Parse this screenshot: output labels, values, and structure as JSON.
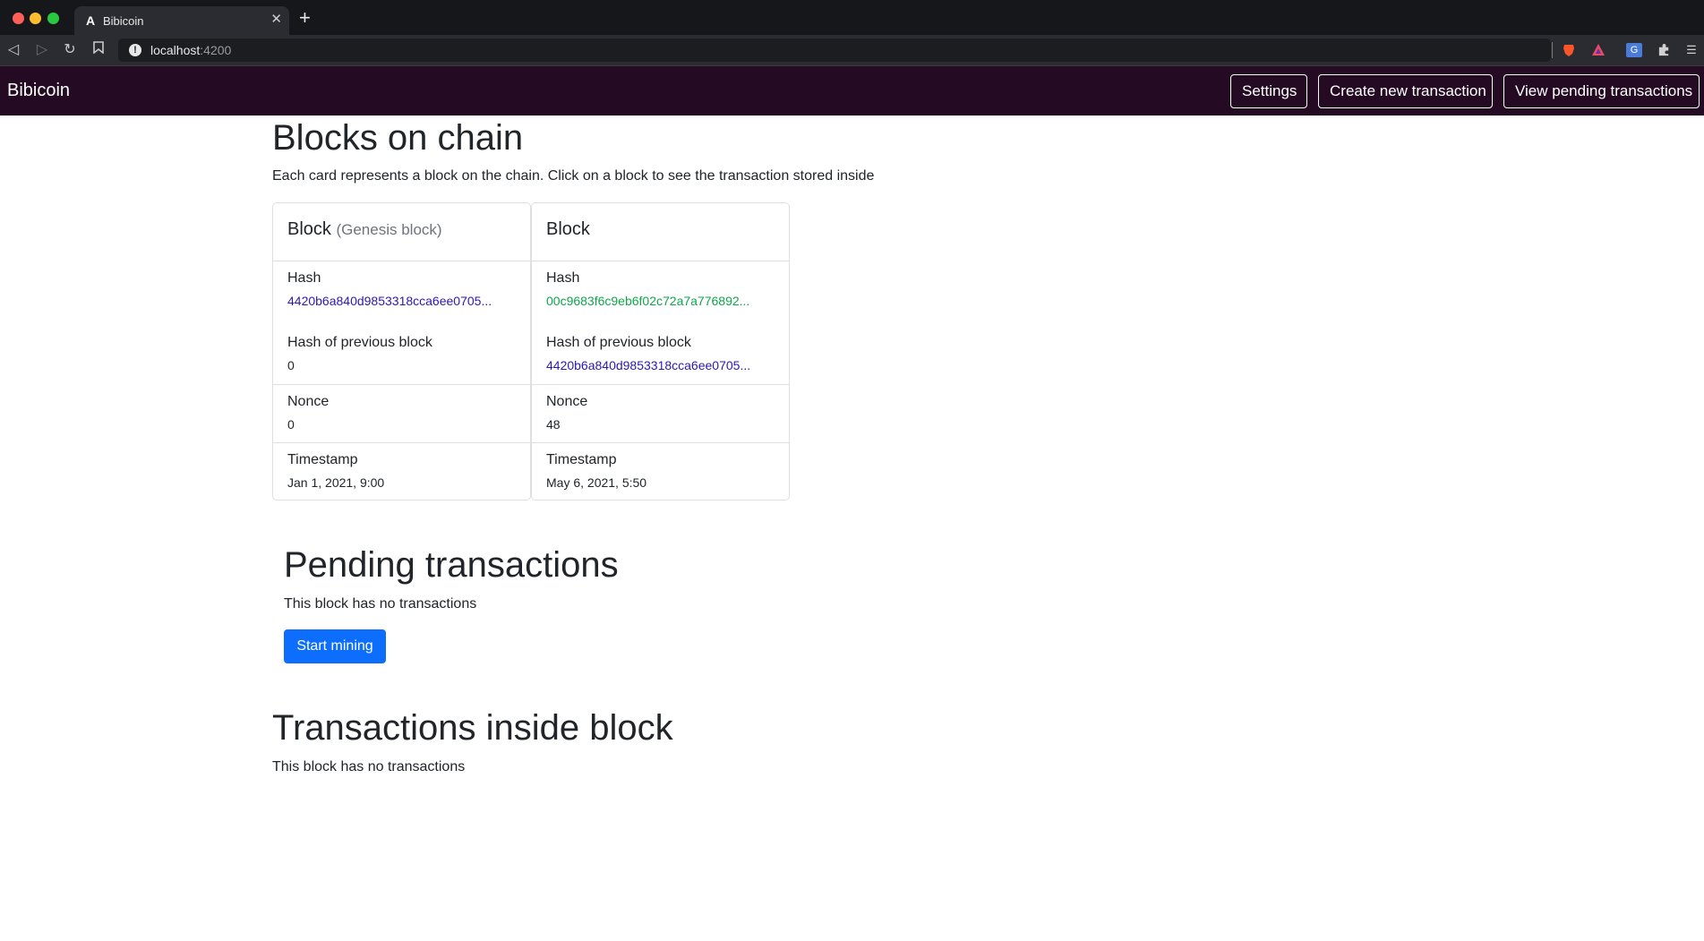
{
  "browser": {
    "tab_title": "Bibicoin",
    "tab_favicon": "A",
    "tab_close": "✕",
    "new_tab": "+",
    "url_host": "localhost",
    "url_port": ":4200",
    "icons": [
      "back-arrow-icon",
      "forward-arrow-icon",
      "reload-icon",
      "bookmark-icon",
      "site-info-icon",
      "brave-shield-icon",
      "brave-rewards-icon",
      "translate-icon",
      "extensions-puzzle-icon",
      "menu-icon"
    ]
  },
  "navbar": {
    "brand": "Bibicoin",
    "settings_label": "Settings",
    "create_label": "Create new transaction",
    "pending_label": "View pending transactions"
  },
  "blocks_section": {
    "title": "Blocks on chain",
    "description": "Each card represents a block on the chain. Click on a block to see the transaction stored inside"
  },
  "blocks": [
    {
      "title": "Block",
      "subtitle": "(Genesis block)",
      "hash_label": "Hash",
      "hash": "4420b6a840d9853318cca6ee0705...",
      "prev_label": "Hash of previous block",
      "prev_hash": "0",
      "nonce_label": "Nonce",
      "nonce": "0",
      "timestamp_label": "Timestamp",
      "timestamp": "Jan 1, 2021, 9:00"
    },
    {
      "title": "Block",
      "subtitle": "",
      "hash_label": "Hash",
      "hash": "00c9683f6c9eb6f02c72a7a776892...",
      "prev_label": "Hash of previous block",
      "prev_hash": "4420b6a840d9853318cca6ee0705...",
      "nonce_label": "Nonce",
      "nonce": "48",
      "timestamp_label": "Timestamp",
      "timestamp": "May 6, 2021, 5:50"
    }
  ],
  "pending_section": {
    "title": "Pending transactions",
    "empty_text": "This block has no transactions",
    "mine_label": "Start mining"
  },
  "inside_section": {
    "title": "Transactions inside block",
    "empty_text": "This block has no transactions"
  },
  "colors": {
    "navbar_bg": "#240a22",
    "primary": "#0d6efd",
    "hash_purple": "#2c18b5",
    "hash_green": "#0fa64b"
  }
}
